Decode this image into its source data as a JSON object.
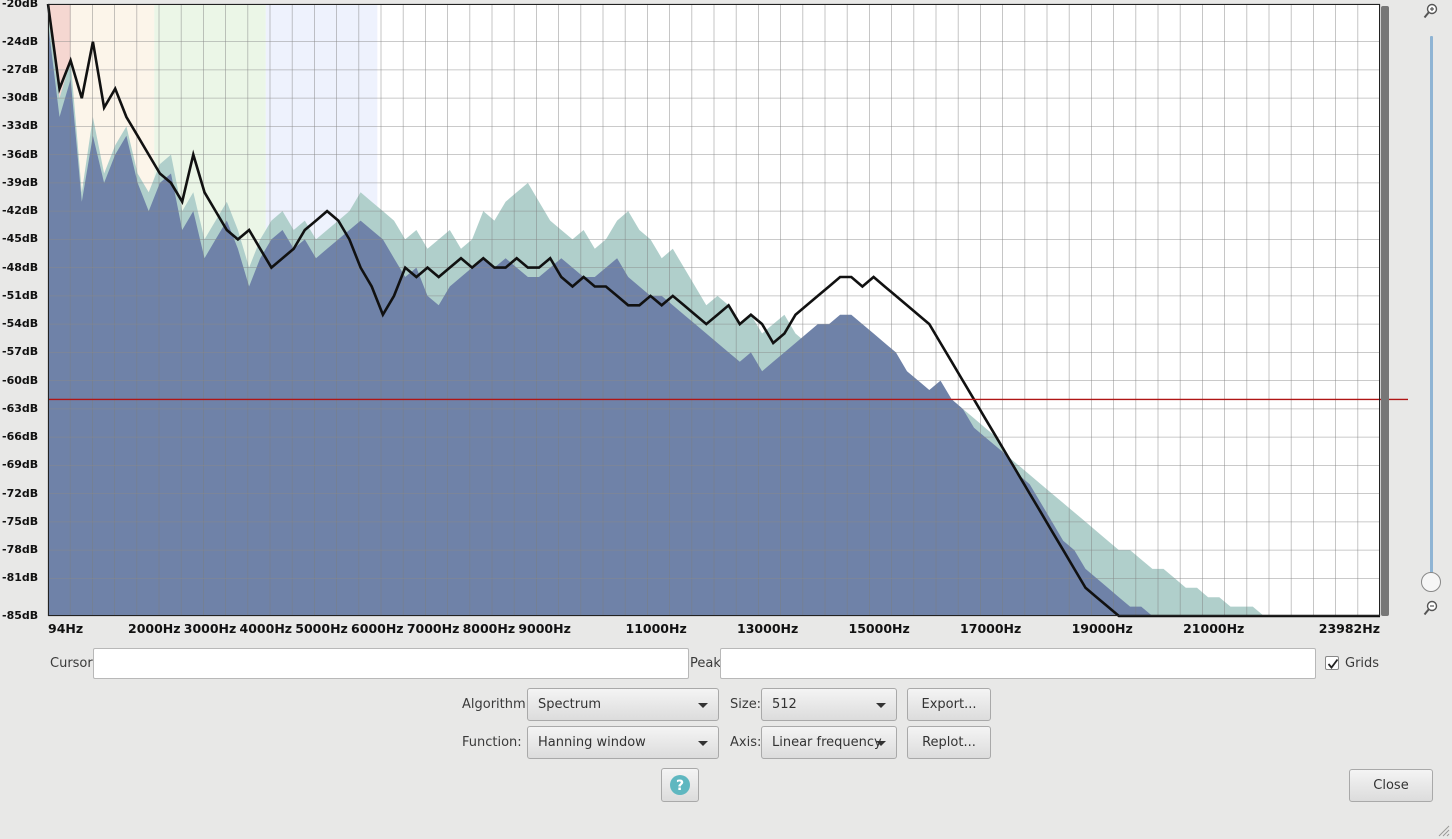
{
  "chart_data": {
    "type": "area",
    "xlabel": "",
    "ylabel": "",
    "xlim": [
      94,
      23982
    ],
    "ylim": [
      -85,
      -20
    ],
    "x_ticks": [
      "94Hz",
      "2000Hz",
      "3000Hz",
      "4000Hz",
      "5000Hz",
      "6000Hz",
      "7000Hz",
      "8000Hz",
      "9000Hz",
      "11000Hz",
      "13000Hz",
      "15000Hz",
      "17000Hz",
      "19000Hz",
      "21000Hz",
      "23982Hz"
    ],
    "y_ticks": [
      "-20dB",
      "-24dB",
      "-27dB",
      "-30dB",
      "-33dB",
      "-36dB",
      "-39dB",
      "-42dB",
      "-45dB",
      "-48dB",
      "-51dB",
      "-54dB",
      "-57dB",
      "-60dB",
      "-63dB",
      "-66dB",
      "-69dB",
      "-72dB",
      "-75dB",
      "-78dB",
      "-81dB",
      "-85dB"
    ],
    "y_ticks_minor": [
      "-27dB",
      "-30dB",
      "-33dB",
      "-60dB",
      "-63dB",
      "-66dB",
      "-69dB"
    ],
    "cursor_level_db": -62,
    "grid": true,
    "series": [
      {
        "color": "#b0cfcb",
        "x": [
          94,
          300,
          500,
          700,
          900,
          1100,
          1300,
          1500,
          1700,
          1900,
          2100,
          2300,
          2500,
          2700,
          2900,
          3100,
          3300,
          3500,
          3700,
          3900,
          4100,
          4300,
          4500,
          4700,
          4900,
          5100,
          5300,
          5500,
          5700,
          5900,
          6100,
          6300,
          6500,
          6700,
          6900,
          7100,
          7300,
          7500,
          7700,
          7900,
          8100,
          8300,
          8500,
          8700,
          8900,
          9100,
          9300,
          9500,
          9700,
          9900,
          10100,
          10300,
          10500,
          10700,
          10900,
          11100,
          11300,
          11500,
          11700,
          11900,
          12100,
          12300,
          12500,
          12700,
          12900,
          13100,
          13300,
          13500,
          13700,
          13900,
          14100,
          14300,
          14500,
          14700,
          14900,
          15100,
          15300,
          15500,
          15700,
          15900,
          16100,
          16300,
          16500,
          16700,
          16900,
          17100,
          17300,
          17500,
          17700,
          17900,
          18100,
          18300,
          18500,
          18700,
          18900,
          19100,
          19300,
          19500,
          19700,
          19900,
          20100,
          20300,
          20500,
          20700,
          20900,
          21100,
          21300,
          21500,
          21700,
          21900,
          22100,
          22300,
          22500,
          22700,
          22900,
          23100,
          23300,
          23500,
          23700,
          23982
        ],
        "values": [
          -21,
          -30,
          -26,
          -40,
          -32,
          -38,
          -35,
          -33,
          -38,
          -40,
          -37,
          -36,
          -42,
          -40,
          -45,
          -43,
          -41,
          -44,
          -48,
          -45,
          -43,
          -42,
          -44,
          -43,
          -45,
          -44,
          -43,
          -42,
          -40,
          -41,
          -42,
          -43,
          -45,
          -44,
          -46,
          -45,
          -44,
          -46,
          -45,
          -42,
          -43,
          -41,
          -40,
          -39,
          -41,
          -43,
          -44,
          -45,
          -44,
          -46,
          -45,
          -43,
          -42,
          -44,
          -45,
          -47,
          -46,
          -48,
          -50,
          -52,
          -51,
          -52,
          -54,
          -53,
          -55,
          -54,
          -53,
          -55,
          -56,
          -54,
          -55,
          -56,
          -55,
          -57,
          -58,
          -59,
          -58,
          -60,
          -61,
          -62,
          -61,
          -62,
          -63,
          -64,
          -65,
          -66,
          -68,
          -69,
          -70,
          -71,
          -72,
          -73,
          -74,
          -75,
          -76,
          -77,
          -78,
          -78,
          -79,
          -80,
          -80,
          -81,
          -82,
          -82,
          -83,
          -83,
          -84,
          -84,
          -84,
          -85,
          -85,
          -85,
          -85,
          -85,
          -85,
          -85,
          -85,
          -85,
          -85,
          -85
        ]
      },
      {
        "color": "#6f82a8",
        "x": [
          94,
          300,
          500,
          700,
          900,
          1100,
          1300,
          1500,
          1700,
          1900,
          2100,
          2300,
          2500,
          2700,
          2900,
          3100,
          3300,
          3500,
          3700,
          3900,
          4100,
          4300,
          4500,
          4700,
          4900,
          5100,
          5300,
          5500,
          5700,
          5900,
          6100,
          6300,
          6500,
          6700,
          6900,
          7100,
          7300,
          7500,
          7700,
          7900,
          8100,
          8300,
          8500,
          8700,
          8900,
          9100,
          9300,
          9500,
          9700,
          9900,
          10100,
          10300,
          10500,
          10700,
          10900,
          11100,
          11300,
          11500,
          11700,
          11900,
          12100,
          12300,
          12500,
          12700,
          12900,
          13100,
          13300,
          13500,
          13700,
          13900,
          14100,
          14300,
          14500,
          14700,
          14900,
          15100,
          15300,
          15500,
          15700,
          15900,
          16100,
          16300,
          16500,
          16700,
          16900,
          17100,
          17300,
          17500,
          17700,
          17900,
          18100,
          18300,
          18500,
          18700,
          18900,
          19100,
          19300,
          19500,
          19700,
          19900,
          20100,
          20300,
          20500,
          20700,
          20900,
          21100,
          21300,
          21500,
          21700,
          21900,
          22100,
          22300,
          22500,
          22700,
          22900,
          23100,
          23300,
          23500,
          23700,
          23982
        ],
        "values": [
          -22,
          -32,
          -28,
          -41,
          -34,
          -39,
          -36,
          -34,
          -39,
          -42,
          -39,
          -38,
          -44,
          -42,
          -47,
          -45,
          -43,
          -46,
          -50,
          -47,
          -45,
          -44,
          -46,
          -45,
          -47,
          -46,
          -45,
          -44,
          -43,
          -44,
          -45,
          -47,
          -49,
          -48,
          -51,
          -52,
          -50,
          -49,
          -48,
          -47,
          -48,
          -47,
          -48,
          -49,
          -49,
          -48,
          -47,
          -48,
          -49,
          -49,
          -48,
          -47,
          -49,
          -50,
          -51,
          -51,
          -52,
          -53,
          -54,
          -55,
          -56,
          -57,
          -58,
          -57,
          -59,
          -58,
          -57,
          -56,
          -55,
          -54,
          -54,
          -53,
          -53,
          -54,
          -55,
          -56,
          -57,
          -59,
          -60,
          -61,
          -60,
          -62,
          -63,
          -65,
          -66,
          -67,
          -68,
          -70,
          -71,
          -73,
          -75,
          -77,
          -78,
          -80,
          -81,
          -82,
          -83,
          -84,
          -84,
          -85,
          -85,
          -85,
          -85,
          -85,
          -85,
          -85,
          -85,
          -85,
          -85,
          -85,
          -85,
          -85,
          -85,
          -85,
          -85,
          -85,
          -85,
          -85,
          -85,
          -85
        ]
      },
      {
        "color": "#111111",
        "x": [
          94,
          300,
          500,
          700,
          900,
          1100,
          1300,
          1500,
          1700,
          1900,
          2100,
          2300,
          2500,
          2700,
          2900,
          3100,
          3300,
          3500,
          3700,
          3900,
          4100,
          4300,
          4500,
          4700,
          4900,
          5100,
          5300,
          5500,
          5700,
          5900,
          6100,
          6300,
          6500,
          6700,
          6900,
          7100,
          7300,
          7500,
          7700,
          7900,
          8100,
          8300,
          8500,
          8700,
          8900,
          9100,
          9300,
          9500,
          9700,
          9900,
          10100,
          10300,
          10500,
          10700,
          10900,
          11100,
          11300,
          11500,
          11700,
          11900,
          12100,
          12300,
          12500,
          12700,
          12900,
          13100,
          13300,
          13500,
          13700,
          13900,
          14100,
          14300,
          14500,
          14700,
          14900,
          15100,
          15300,
          15500,
          15700,
          15900,
          16100,
          16300,
          16500,
          16700,
          16900,
          17100,
          17300,
          17500,
          17700,
          17900,
          18100,
          18300,
          18500,
          18700,
          18900,
          19100,
          19300,
          19500,
          19700,
          19900,
          20100,
          20300,
          20500,
          20700,
          20900,
          21100,
          21300,
          21500,
          21700,
          21900,
          22100,
          22300,
          22500,
          22700,
          22900,
          23100,
          23300,
          23500,
          23700,
          23982
        ],
        "values": [
          -20,
          -29,
          -26,
          -30,
          -24,
          -31,
          -29,
          -32,
          -34,
          -36,
          -38,
          -39,
          -41,
          -36,
          -40,
          -42,
          -44,
          -45,
          -44,
          -46,
          -48,
          -47,
          -46,
          -44,
          -43,
          -42,
          -43,
          -45,
          -48,
          -50,
          -53,
          -51,
          -48,
          -49,
          -48,
          -49,
          -48,
          -47,
          -48,
          -47,
          -48,
          -48,
          -47,
          -48,
          -48,
          -47,
          -49,
          -50,
          -49,
          -50,
          -50,
          -51,
          -52,
          -52,
          -51,
          -52,
          -51,
          -52,
          -53,
          -54,
          -53,
          -52,
          -54,
          -53,
          -54,
          -56,
          -55,
          -53,
          -52,
          -51,
          -50,
          -49,
          -49,
          -50,
          -49,
          -50,
          -51,
          -52,
          -53,
          -54,
          -56,
          -58,
          -60,
          -62,
          -64,
          -66,
          -68,
          -70,
          -72,
          -74,
          -76,
          -78,
          -80,
          -82,
          -83,
          -84,
          -85,
          -85,
          -85,
          -85,
          -85,
          -85,
          -85,
          -85,
          -85,
          -85,
          -85,
          -85,
          -85,
          -85,
          -85,
          -85,
          -85,
          -85,
          -85,
          -85,
          -85,
          -85,
          -85,
          -85
        ]
      }
    ],
    "bands": [
      {
        "from": 94,
        "to": 500,
        "color": "#f2c9c2"
      },
      {
        "from": 500,
        "to": 2000,
        "color": "#fbf1e3"
      },
      {
        "from": 2000,
        "to": 4000,
        "color": "#e4f3df"
      },
      {
        "from": 4000,
        "to": 6000,
        "color": "#e8eefc"
      }
    ]
  },
  "controls": {
    "cursor_label": "Cursor:",
    "cursor_value": "",
    "peak_label": "Peak:",
    "peak_value": "",
    "grids_label": "Grids",
    "grids_checked": true,
    "algorithm_label": "Algorithm:",
    "algorithm_value": "Spectrum",
    "size_label": "Size:",
    "size_value": "512",
    "export_label": "Export...",
    "function_label": "Function:",
    "function_value": "Hanning window",
    "axis_label": "Axis:",
    "axis_value": "Linear frequency",
    "replot_label": "Replot...",
    "help_label": "?",
    "close_label": "Close"
  },
  "icons": {
    "zoom_in": "zoom-in-icon",
    "zoom_out": "zoom-out-icon",
    "help": "help-icon",
    "resize": "resize-grip-icon"
  }
}
